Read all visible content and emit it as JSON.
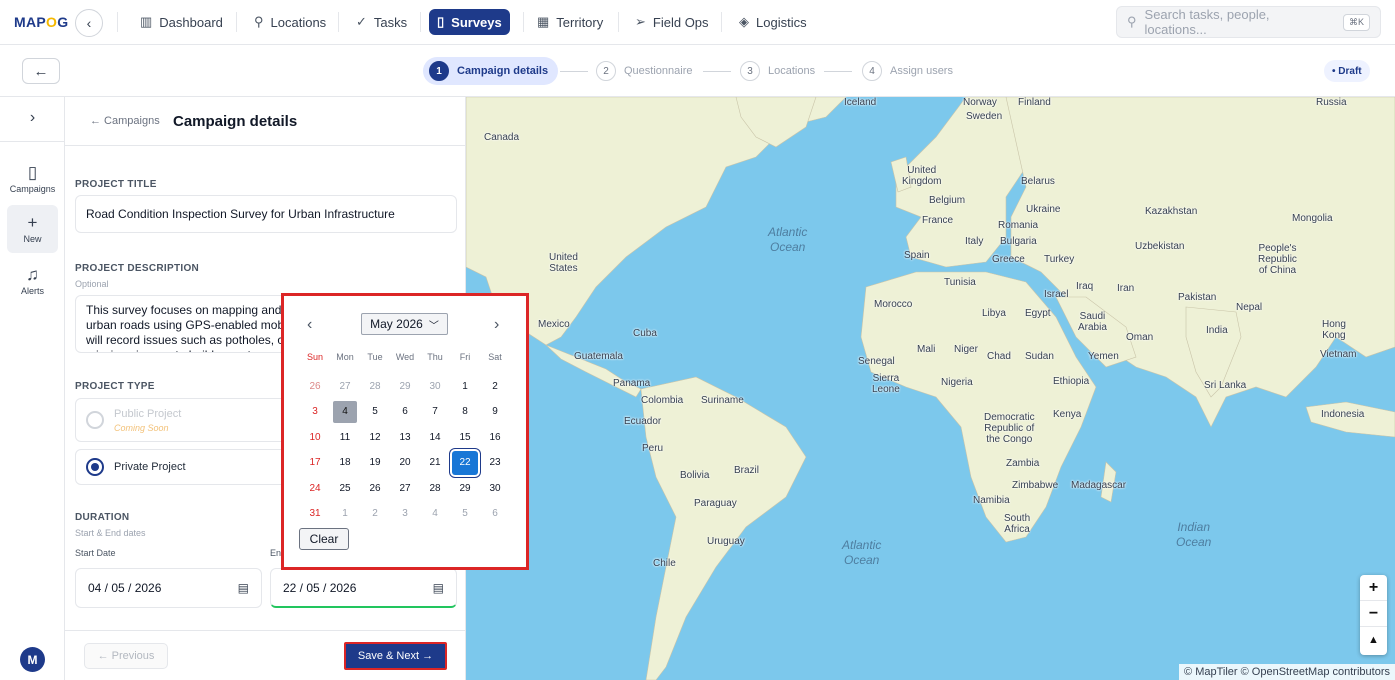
{
  "app": {
    "logo_left": "MAP",
    "logo_mid": "O",
    "logo_right": "G"
  },
  "nav": {
    "back_icon": "chevron-left",
    "items": [
      {
        "label": "Dashboard",
        "icon": "bar-chart-icon"
      },
      {
        "label": "Locations",
        "icon": "map-pin-icon"
      },
      {
        "label": "Tasks",
        "icon": "check-icon"
      },
      {
        "label": "Surveys",
        "icon": "clipboard-icon",
        "active": true
      },
      {
        "label": "Territory",
        "icon": "map-icon"
      },
      {
        "label": "Field Ops",
        "icon": "send-icon"
      },
      {
        "label": "Logistics",
        "icon": "box-icon"
      }
    ],
    "search_placeholder": "Search tasks, people, locations...",
    "search_shortcut": "⌘K"
  },
  "stepper": {
    "steps": [
      {
        "num": "1",
        "label": "Campaign details",
        "active": true
      },
      {
        "num": "2",
        "label": "Questionnaire"
      },
      {
        "num": "3",
        "label": "Locations"
      },
      {
        "num": "4",
        "label": "Assign users"
      }
    ],
    "status_badge": "• Draft"
  },
  "rail": {
    "items": [
      {
        "label": "Campaigns",
        "icon": "clipboard-icon"
      },
      {
        "label": "New",
        "icon": "plus-icon",
        "selected": true
      },
      {
        "label": "Alerts",
        "icon": "bell-icon"
      }
    ],
    "avatar_initial": "M"
  },
  "form": {
    "breadcrumb": "← Campaigns",
    "title": "Campaign details",
    "project_title_label": "PROJECT TITLE",
    "project_title_value": "Road Condition Inspection Survey for Urban Infrastructure",
    "description_label": "PROJECT DESCRIPTION",
    "description_optional": "Optional",
    "description_value": "This survey focuses on mapping and assessing the condition of urban roads using GPS-enabled mobile data collection. Field teams will record issues such as potholes, cracks, drainage problems and missing signage to build a geotagged dataset that supports better maintenance planning.",
    "project_type_label": "PROJECT TYPE",
    "public_label": "Public Project",
    "public_note": "Coming Soon",
    "private_label": "Private Project",
    "duration_label": "DURATION",
    "duration_sub": "Start & End dates",
    "start_label": "Start Date",
    "end_label": "End Date",
    "start_value": "04 / 05 / 2026",
    "end_value": "22 / 05 / 2026",
    "previous_button": "← Previous",
    "next_button": "Save & Next →"
  },
  "datepicker": {
    "month_label": "May 2026",
    "weekdays": [
      "Sun",
      "Mon",
      "Tue",
      "Wed",
      "Thu",
      "Fri",
      "Sat"
    ],
    "weeks": [
      [
        "26",
        "27",
        "28",
        "29",
        "30",
        "1",
        "2"
      ],
      [
        "3",
        "4",
        "5",
        "6",
        "7",
        "8",
        "9"
      ],
      [
        "10",
        "11",
        "12",
        "13",
        "14",
        "15",
        "16"
      ],
      [
        "17",
        "18",
        "19",
        "20",
        "21",
        "22",
        "23"
      ],
      [
        "24",
        "25",
        "26",
        "27",
        "28",
        "29",
        "30"
      ],
      [
        "31",
        "1",
        "2",
        "3",
        "4",
        "5",
        "6"
      ]
    ],
    "today": "4",
    "selected": "22",
    "clear_button": "Clear"
  },
  "map": {
    "labels": [
      "Iceland",
      "Norway",
      "Sweden",
      "Finland",
      "Russia",
      "Canada",
      "United Kingdom",
      "Belarus",
      "Belgium",
      "Ukraine",
      "France",
      "Romania",
      "Kazakhstan",
      "Mongolia",
      "Italy",
      "Bulgaria",
      "Uzbekistan",
      "People's Republic of China",
      "Spain",
      "Greece",
      "Turkey",
      "United States",
      "Tunisia",
      "Iraq",
      "Iran",
      "Israel",
      "Pakistan",
      "Nepal",
      "Morocco",
      "Libya",
      "Egypt",
      "Saudi Arabia",
      "India",
      "Mexico",
      "Cuba",
      "Oman",
      "Hong Kong",
      "Guatemala",
      "Mali",
      "Niger",
      "Chad",
      "Sudan",
      "Yemen",
      "Vietnam",
      "Senegal",
      "Panama",
      "Sierra Leone",
      "Nigeria",
      "Ethiopia",
      "Sri Lanka",
      "Colombia",
      "Suriname",
      "Ecuador",
      "Kenya",
      "Democratic Republic of the Congo",
      "Indonesia",
      "Peru",
      "Brazil",
      "Bolivia",
      "Zambia",
      "Zimbabwe",
      "Madagascar",
      "Paraguay",
      "Namibia",
      "South Africa",
      "Uruguay",
      "Chile"
    ],
    "oceans": [
      "Atlantic Ocean",
      "Atlantic Ocean",
      "Indian Ocean"
    ],
    "zoom_in": "+",
    "zoom_out": "−",
    "compass": "▲",
    "attribution": "© MapTiler © OpenStreetMap contributors"
  },
  "colors": {
    "brand": "#1e3a8a",
    "highlight": "#dc2626",
    "selected_day": "#1877d6",
    "water": "#7cc8ec",
    "land": "#eef1d6"
  }
}
